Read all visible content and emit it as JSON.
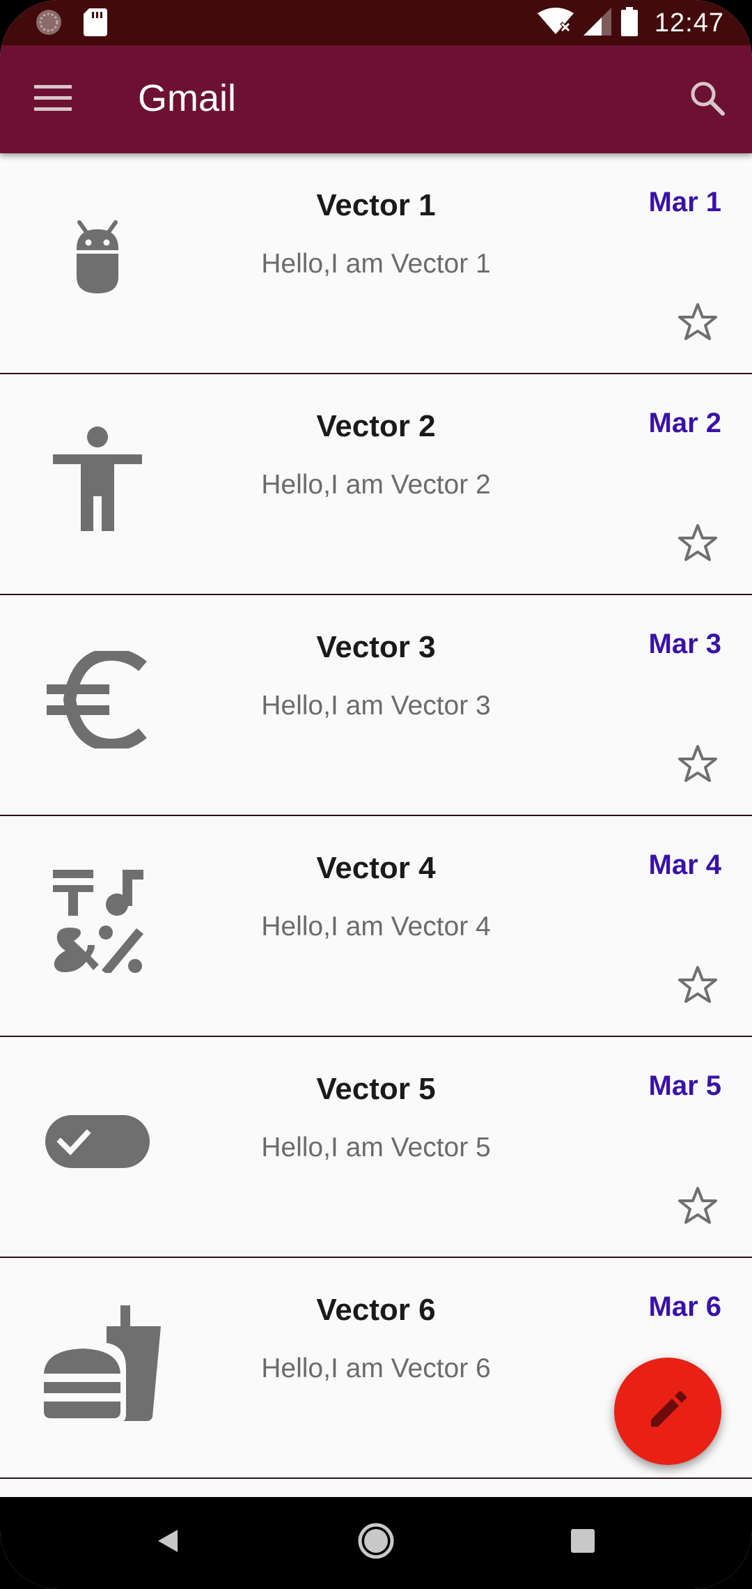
{
  "status_bar": {
    "time": "12:47",
    "icons": [
      "app-notification-icon",
      "sd-card-icon",
      "wifi-icon",
      "signal-icon",
      "battery-icon"
    ]
  },
  "app_bar": {
    "title": "Gmail",
    "menu_icon": "menu-icon",
    "search_icon": "search-icon",
    "background": "#6d1132"
  },
  "emails": [
    {
      "sender": "Vector 1",
      "preview": "Hello,I am Vector 1",
      "date": "Mar 1",
      "icon": "android-icon"
    },
    {
      "sender": "Vector 2",
      "preview": "Hello,I am Vector 2",
      "date": "Mar 2",
      "icon": "accessibility-icon"
    },
    {
      "sender": "Vector 3",
      "preview": "Hello,I am Vector 3",
      "date": "Mar 3",
      "icon": "euro-icon"
    },
    {
      "sender": "Vector 4",
      "preview": "Hello,I am Vector 4",
      "date": "Mar 4",
      "icon": "emoji-symbols-icon"
    },
    {
      "sender": "Vector 5",
      "preview": "Hello,I am Vector 5",
      "date": "Mar 5",
      "icon": "toggle-on-icon"
    },
    {
      "sender": "Vector 6",
      "preview": "Hello,I am Vector 6",
      "date": "Mar 6",
      "icon": "fastfood-icon"
    }
  ],
  "fab": {
    "icon": "edit-icon",
    "color": "#e82114"
  },
  "nav_bar": {
    "buttons": [
      "back-icon",
      "home-icon",
      "recents-icon"
    ]
  },
  "colors": {
    "date": "#3a11a8",
    "status_bar": "#420a0c",
    "icon_gray": "#6f6f6f"
  }
}
